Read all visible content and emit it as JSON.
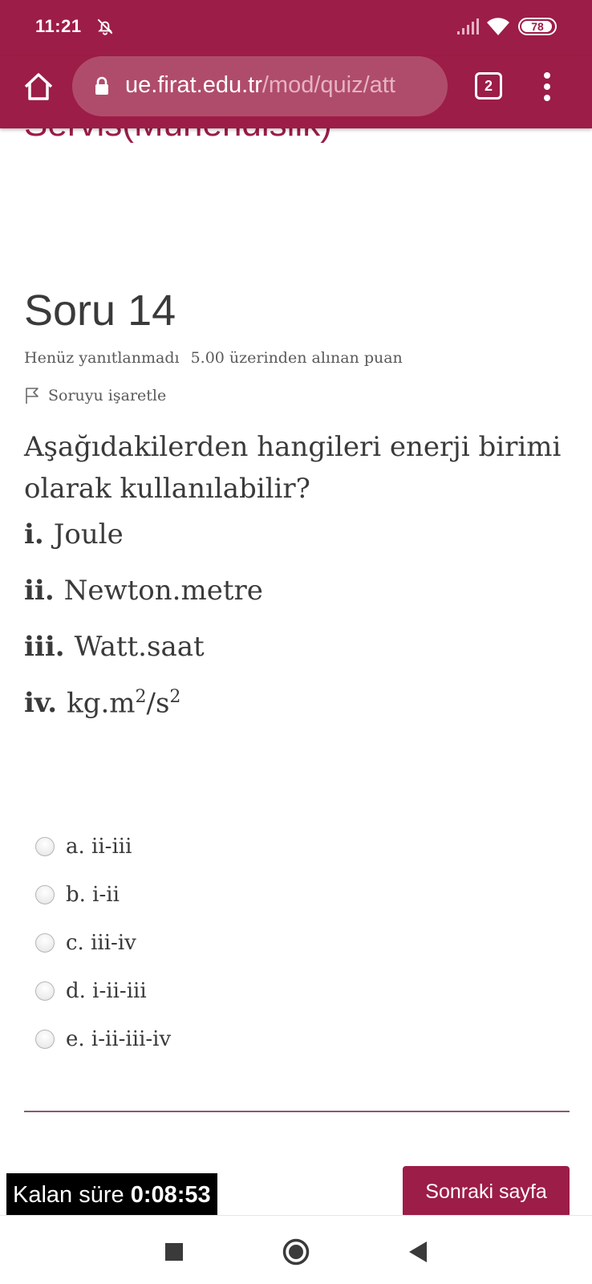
{
  "status_bar": {
    "time": "11:21",
    "battery": "78"
  },
  "browser": {
    "url_host": "ue.firat.edu.tr",
    "url_path": "/mod/quiz/att",
    "tab_count": "2"
  },
  "page": {
    "cut_heading": "Servis(Mühendislik)",
    "question_title": "Soru 14",
    "status": "Henüz yanıtlanmadı",
    "grade": "5.00 üzerinden alınan puan",
    "flag_label": "Soruyu işaretle",
    "question_text": "Aşağıdakilerden hangileri enerji birimi olarak kullanılabilir?",
    "items": [
      {
        "num": "i.",
        "text": "Joule"
      },
      {
        "num": "ii.",
        "text": "Newton.metre"
      },
      {
        "num": "iii.",
        "text": "Watt.saat"
      },
      {
        "num": "iv.",
        "text": "kg.m",
        "sup1": "2",
        "mid": "/s",
        "sup2": "2"
      }
    ],
    "options": [
      {
        "label": "a. ii-iii",
        "selected": false
      },
      {
        "label": "b. i-ii",
        "selected": false
      },
      {
        "label": "c. iii-iv",
        "selected": false
      },
      {
        "label": "d. i-ii-iii",
        "selected": false
      },
      {
        "label": "e. i-ii-iii-iv",
        "selected": false
      }
    ],
    "timer_label": "Kalan süre",
    "timer_value": "0:08:53",
    "next_button": "Sonraki sayfa"
  },
  "colors": {
    "accent": "#9c1d47",
    "url_bar": "#b04c6b"
  }
}
